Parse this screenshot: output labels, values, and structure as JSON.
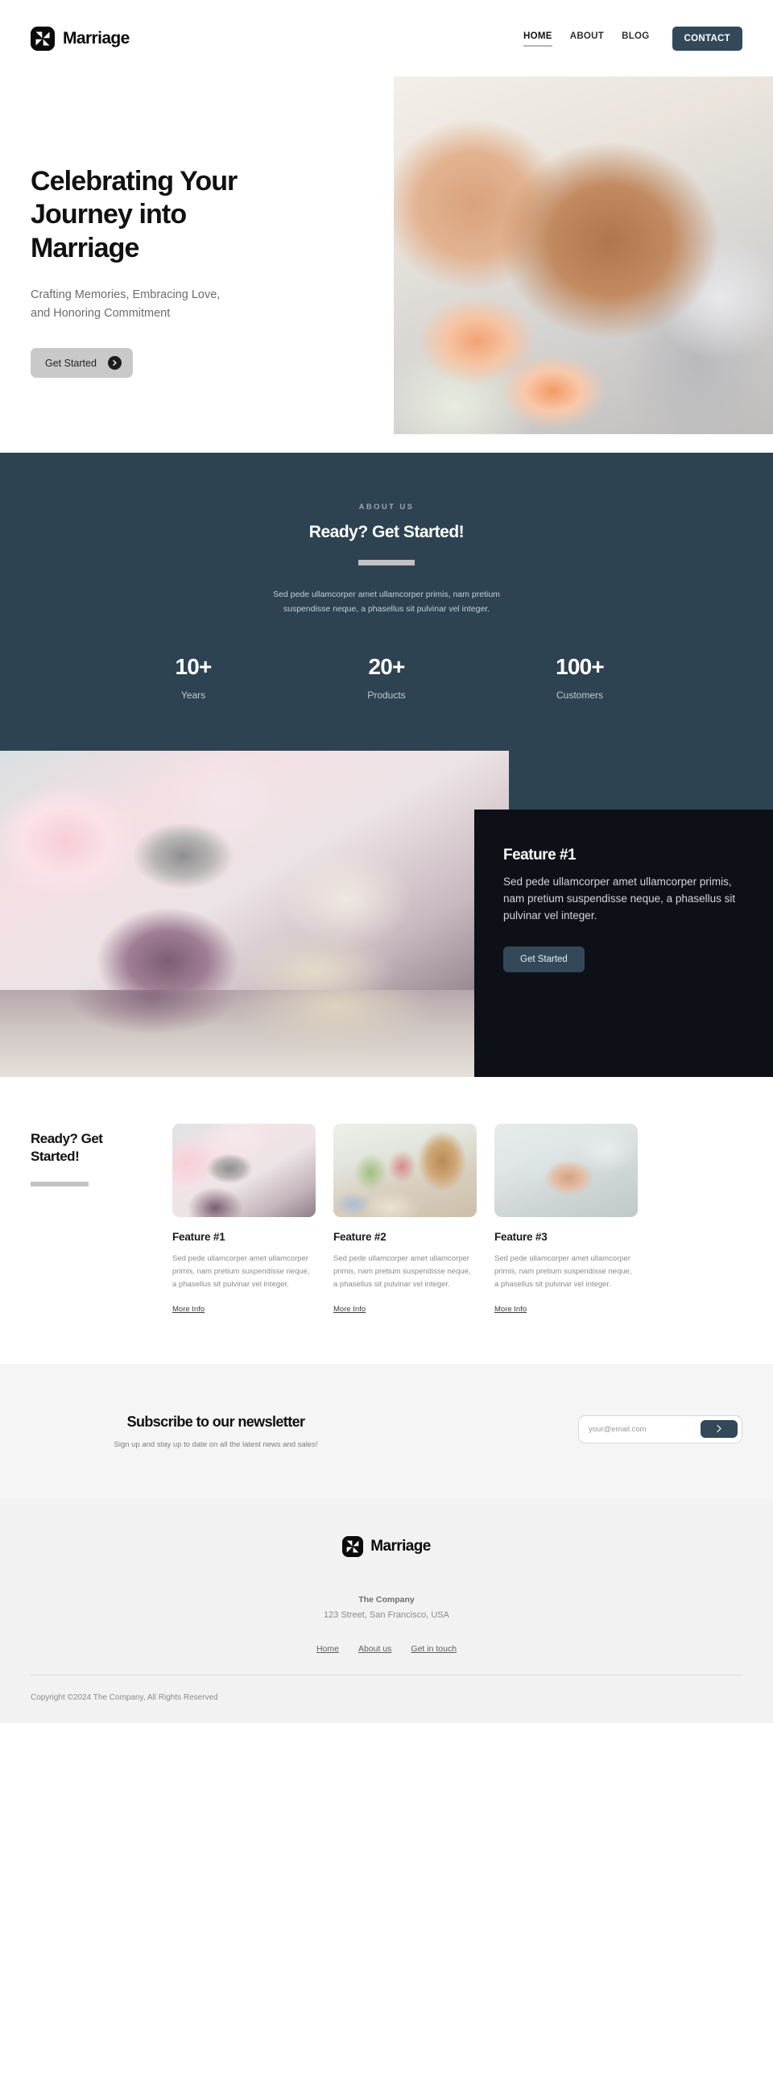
{
  "header": {
    "brand": "Marriage",
    "logo_icon": "pinwheel-logo-icon",
    "nav": [
      {
        "label": "HOME",
        "active": true
      },
      {
        "label": "ABOUT",
        "active": false
      },
      {
        "label": "BLOG",
        "active": false
      }
    ],
    "cta_label": "CONTACT",
    "cta_color": "#33495a"
  },
  "hero": {
    "title": "Celebrating Your Journey into Marriage",
    "subtitle": "Crafting Memories, Embracing Love, and Honoring Commitment",
    "button_label": "Get Started",
    "button_icon": "arrow-right-circle-icon",
    "image_alt": "couple-holding-hands-with-wedding-rings"
  },
  "about": {
    "eyebrow": "ABOUT US",
    "title": "Ready? Get Started!",
    "body": "Sed pede ullamcorper amet ullamcorper primis, nam pretium suspendisse neque, a phasellus sit pulvinar vel integer.",
    "background_color": "#2d4352",
    "stats": [
      {
        "value": "10+",
        "label": "Years"
      },
      {
        "value": "20+",
        "label": "Products"
      },
      {
        "value": "100+",
        "label": "Customers"
      }
    ]
  },
  "feature_band": {
    "image_alt": "wedding-rings-on-bouquet",
    "card": {
      "title": "Feature #1",
      "body": "Sed pede ullamcorper amet ullamcorper primis, nam pretium suspendisse neque, a phasellus sit pulvinar vel integer.",
      "button_label": "Get Started",
      "background_color": "#0d1117",
      "button_color": "#33495a"
    }
  },
  "features": {
    "heading": "Ready? Get Started!",
    "cards": [
      {
        "title": "Feature #1",
        "body": "Sed pede ullamcorper amet ullamcorper primis, nam pretium suspendisse neque, a phasellus sit pulvinar vel integer.",
        "link_label": "More Info",
        "image_alt": "rings-on-pink-bouquet"
      },
      {
        "title": "Feature #2",
        "body": "Sed pede ullamcorper amet ullamcorper primis, nam pretium suspendisse neque, a phasellus sit pulvinar vel integer.",
        "link_label": "More Info",
        "image_alt": "reception-table-with-flowers"
      },
      {
        "title": "Feature #3",
        "body": "Sed pede ullamcorper amet ullamcorper primis, nam pretium suspendisse neque, a phasellus sit pulvinar vel integer.",
        "link_label": "More Info",
        "image_alt": "hands-exchanging-ring"
      }
    ]
  },
  "newsletter": {
    "title": "Subscribe to our newsletter",
    "subtitle": "Sign up and stay up to date on all the latest news and sales!",
    "input_placeholder": "your@email.com",
    "input_value": "",
    "submit_icon": "chevron-right-icon",
    "background_color": "#f5f5f5"
  },
  "footer": {
    "brand": "Marriage",
    "logo_icon": "pinwheel-logo-icon",
    "company": "The Company",
    "address": "123 Street, San Francisco, USA",
    "links": [
      {
        "label": "Home"
      },
      {
        "label": "About us"
      },
      {
        "label": "Get in touch"
      }
    ],
    "copyright": "Copyright ©2024 The Company, All Rights Reserved"
  }
}
